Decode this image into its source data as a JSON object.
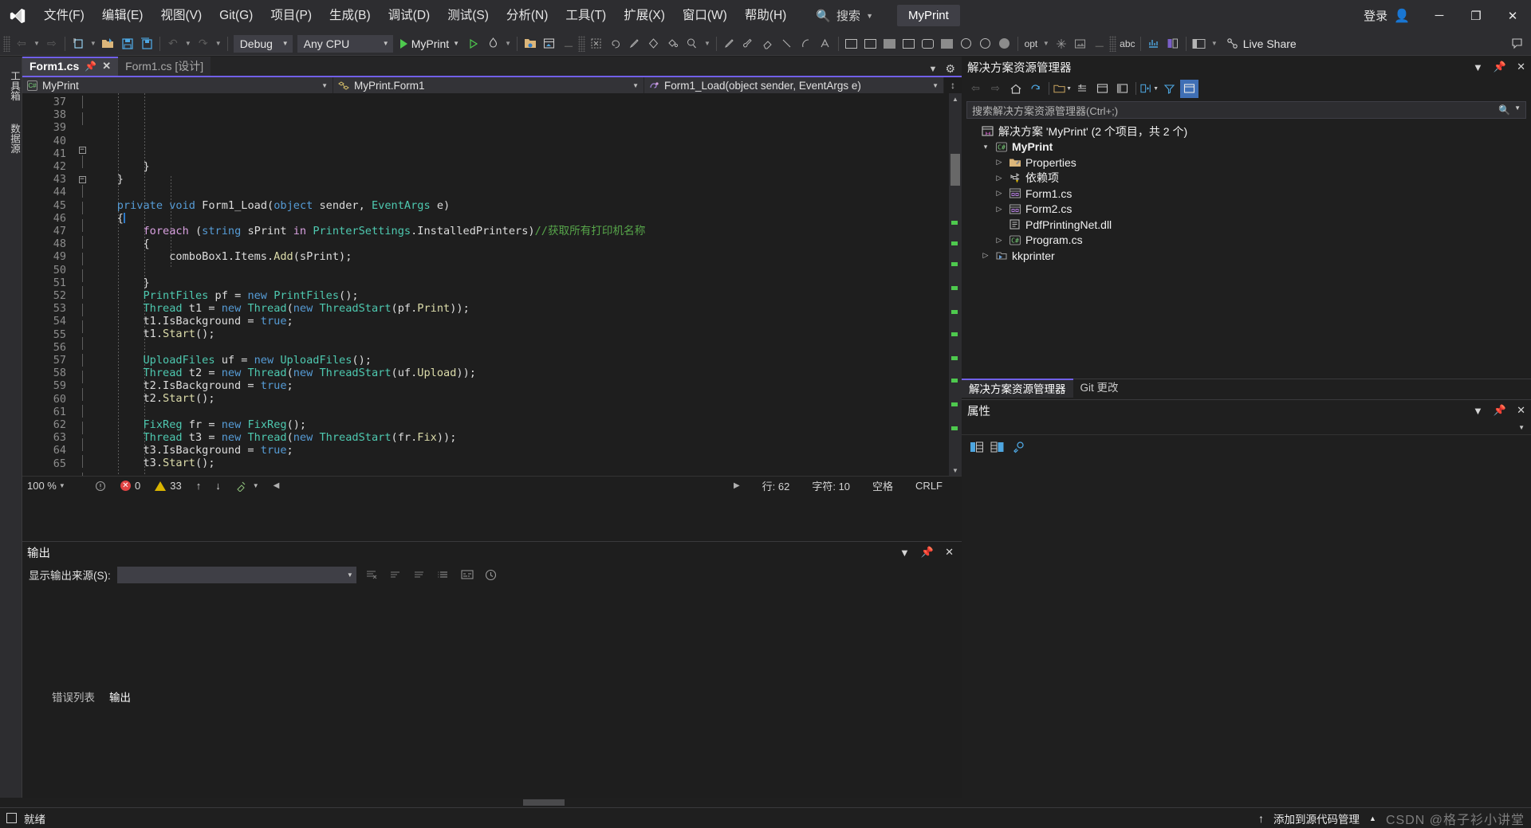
{
  "titlebar": {
    "logo_icon": "visual-studio-logo",
    "menus": [
      "文件(F)",
      "编辑(E)",
      "视图(V)",
      "Git(G)",
      "项目(P)",
      "生成(B)",
      "调试(D)",
      "测试(S)",
      "分析(N)",
      "工具(T)",
      "扩展(X)",
      "窗口(W)",
      "帮助(H)"
    ],
    "search_icon": "search-icon",
    "search_label": "搜索",
    "project_badge": "MyPrint",
    "signin_label": "登录",
    "signin_icon": "person-icon",
    "minimize": "─",
    "maximize": "❐",
    "close": "✕"
  },
  "toolbar": {
    "nav_back": "←",
    "nav_forward": "→",
    "new_item_icon": "new-item-icon",
    "open_file_icon": "open-folder-icon",
    "save_icon": "save-icon",
    "save_all_icon": "save-all-icon",
    "undo_icon": "undo-icon",
    "redo_icon": "redo-icon",
    "config_value": "Debug",
    "platform_value": "Any CPU",
    "start_label": "MyPrint",
    "start_icon": "play-icon",
    "hot_reload_icon": "hot-reload-icon",
    "live_share_label": "Live Share",
    "live_share_icon": "live-share-icon",
    "opt_label": "opt",
    "abc_label": "abc",
    "feedback_icon": "feedback-icon"
  },
  "left_rail": {
    "toolbox": "工具箱",
    "data_sources": "数据源"
  },
  "editor": {
    "tabs": [
      {
        "label": "Form1.cs",
        "active": true,
        "pin_icon": "pin-icon",
        "close_icon": "close-icon"
      },
      {
        "label": "Form1.cs [设计]",
        "active": false
      }
    ],
    "nav": {
      "project": "MyPrint",
      "project_icon": "csharp-project-icon",
      "class": "MyPrint.Form1",
      "class_icon": "class-icon",
      "member": "Form1_Load(object sender, EventArgs e)",
      "member_icon": "method-icon"
    },
    "first_line": 37,
    "lines": [
      {
        "n": 37,
        "fold": "line",
        "tokens": [
          {
            "t": "        }",
            "c": "pl"
          }
        ]
      },
      {
        "n": 38,
        "fold": "line",
        "tokens": [
          {
            "t": "    }",
            "c": "pl"
          }
        ]
      },
      {
        "n": 39,
        "fold": "",
        "tokens": [
          {
            "t": "",
            "c": "pl"
          }
        ]
      },
      {
        "n": 40,
        "fold": "minus",
        "tokens": [
          {
            "t": "    ",
            "c": "pl"
          },
          {
            "t": "private",
            "c": "k"
          },
          {
            "t": " ",
            "c": "pl"
          },
          {
            "t": "void",
            "c": "k"
          },
          {
            "t": " Form1_Load(",
            "c": "pl"
          },
          {
            "t": "object",
            "c": "k"
          },
          {
            "t": " sender, ",
            "c": "pl"
          },
          {
            "t": "EventArgs",
            "c": "t"
          },
          {
            "t": " e)",
            "c": "pl"
          }
        ]
      },
      {
        "n": 41,
        "fold": "line",
        "tokens": [
          {
            "t": "    {",
            "c": "pl"
          }
        ]
      },
      {
        "n": 42,
        "fold": "minus",
        "tokens": [
          {
            "t": "        ",
            "c": "pl"
          },
          {
            "t": "foreach",
            "c": "ctrl"
          },
          {
            "t": " (",
            "c": "pl"
          },
          {
            "t": "string",
            "c": "k"
          },
          {
            "t": " sPrint ",
            "c": "pl"
          },
          {
            "t": "in",
            "c": "ctrl"
          },
          {
            "t": " ",
            "c": "pl"
          },
          {
            "t": "PrinterSettings",
            "c": "t"
          },
          {
            "t": ".InstalledPrinters)",
            "c": "pl"
          },
          {
            "t": "//获取所有打印机名称",
            "c": "cm"
          }
        ]
      },
      {
        "n": 43,
        "fold": "line",
        "tokens": [
          {
            "t": "        {",
            "c": "pl"
          }
        ]
      },
      {
        "n": 44,
        "fold": "line",
        "tokens": [
          {
            "t": "            comboBox1.Items.",
            "c": "pl"
          },
          {
            "t": "Add",
            "c": "m"
          },
          {
            "t": "(sPrint);",
            "c": "pl"
          }
        ]
      },
      {
        "n": 45,
        "fold": "line",
        "tokens": [
          {
            "t": "",
            "c": "pl"
          }
        ]
      },
      {
        "n": 46,
        "fold": "line",
        "tokens": [
          {
            "t": "        }",
            "c": "pl"
          }
        ]
      },
      {
        "n": 47,
        "fold": "line",
        "tokens": [
          {
            "t": "        ",
            "c": "pl"
          },
          {
            "t": "PrintFiles",
            "c": "t"
          },
          {
            "t": " pf = ",
            "c": "pl"
          },
          {
            "t": "new",
            "c": "k"
          },
          {
            "t": " ",
            "c": "pl"
          },
          {
            "t": "PrintFiles",
            "c": "t"
          },
          {
            "t": "();",
            "c": "pl"
          }
        ]
      },
      {
        "n": 48,
        "fold": "line",
        "tokens": [
          {
            "t": "        ",
            "c": "pl"
          },
          {
            "t": "Thread",
            "c": "t"
          },
          {
            "t": " t1 = ",
            "c": "pl"
          },
          {
            "t": "new",
            "c": "k"
          },
          {
            "t": " ",
            "c": "pl"
          },
          {
            "t": "Thread",
            "c": "t"
          },
          {
            "t": "(",
            "c": "pl"
          },
          {
            "t": "new",
            "c": "k"
          },
          {
            "t": " ",
            "c": "pl"
          },
          {
            "t": "ThreadStart",
            "c": "t"
          },
          {
            "t": "(pf.",
            "c": "pl"
          },
          {
            "t": "Print",
            "c": "m"
          },
          {
            "t": "));",
            "c": "pl"
          }
        ]
      },
      {
        "n": 49,
        "fold": "line",
        "tokens": [
          {
            "t": "        t1.IsBackground = ",
            "c": "pl"
          },
          {
            "t": "true",
            "c": "k"
          },
          {
            "t": ";",
            "c": "pl"
          }
        ]
      },
      {
        "n": 50,
        "fold": "line",
        "tokens": [
          {
            "t": "        t1.",
            "c": "pl"
          },
          {
            "t": "Start",
            "c": "m"
          },
          {
            "t": "();",
            "c": "pl"
          }
        ]
      },
      {
        "n": 51,
        "fold": "line",
        "tokens": [
          {
            "t": "",
            "c": "pl"
          }
        ]
      },
      {
        "n": 52,
        "fold": "line",
        "tokens": [
          {
            "t": "        ",
            "c": "pl"
          },
          {
            "t": "UploadFiles",
            "c": "t"
          },
          {
            "t": " uf = ",
            "c": "pl"
          },
          {
            "t": "new",
            "c": "k"
          },
          {
            "t": " ",
            "c": "pl"
          },
          {
            "t": "UploadFiles",
            "c": "t"
          },
          {
            "t": "();",
            "c": "pl"
          }
        ]
      },
      {
        "n": 53,
        "fold": "line",
        "tokens": [
          {
            "t": "        ",
            "c": "pl"
          },
          {
            "t": "Thread",
            "c": "t"
          },
          {
            "t": " t2 = ",
            "c": "pl"
          },
          {
            "t": "new",
            "c": "k"
          },
          {
            "t": " ",
            "c": "pl"
          },
          {
            "t": "Thread",
            "c": "t"
          },
          {
            "t": "(",
            "c": "pl"
          },
          {
            "t": "new",
            "c": "k"
          },
          {
            "t": " ",
            "c": "pl"
          },
          {
            "t": "ThreadStart",
            "c": "t"
          },
          {
            "t": "(uf.",
            "c": "pl"
          },
          {
            "t": "Upload",
            "c": "m"
          },
          {
            "t": "));",
            "c": "pl"
          }
        ]
      },
      {
        "n": 54,
        "fold": "line",
        "tokens": [
          {
            "t": "        t2.IsBackground = ",
            "c": "pl"
          },
          {
            "t": "true",
            "c": "k"
          },
          {
            "t": ";",
            "c": "pl"
          }
        ]
      },
      {
        "n": 55,
        "fold": "line",
        "tokens": [
          {
            "t": "        t2.",
            "c": "pl"
          },
          {
            "t": "Start",
            "c": "m"
          },
          {
            "t": "();",
            "c": "pl"
          }
        ]
      },
      {
        "n": 56,
        "fold": "line",
        "tokens": [
          {
            "t": "",
            "c": "pl"
          }
        ]
      },
      {
        "n": 57,
        "fold": "line",
        "tokens": [
          {
            "t": "        ",
            "c": "pl"
          },
          {
            "t": "FixReg",
            "c": "t"
          },
          {
            "t": " fr = ",
            "c": "pl"
          },
          {
            "t": "new",
            "c": "k"
          },
          {
            "t": " ",
            "c": "pl"
          },
          {
            "t": "FixReg",
            "c": "t"
          },
          {
            "t": "();",
            "c": "pl"
          }
        ]
      },
      {
        "n": 58,
        "fold": "line",
        "tokens": [
          {
            "t": "        ",
            "c": "pl"
          },
          {
            "t": "Thread",
            "c": "t"
          },
          {
            "t": " t3 = ",
            "c": "pl"
          },
          {
            "t": "new",
            "c": "k"
          },
          {
            "t": " ",
            "c": "pl"
          },
          {
            "t": "Thread",
            "c": "t"
          },
          {
            "t": "(",
            "c": "pl"
          },
          {
            "t": "new",
            "c": "k"
          },
          {
            "t": " ",
            "c": "pl"
          },
          {
            "t": "ThreadStart",
            "c": "t"
          },
          {
            "t": "(fr.",
            "c": "pl"
          },
          {
            "t": "Fix",
            "c": "m"
          },
          {
            "t": "));",
            "c": "pl"
          }
        ]
      },
      {
        "n": 59,
        "fold": "line",
        "tokens": [
          {
            "t": "        t3.IsBackground = ",
            "c": "pl"
          },
          {
            "t": "true",
            "c": "k"
          },
          {
            "t": ";",
            "c": "pl"
          }
        ]
      },
      {
        "n": 60,
        "fold": "line",
        "tokens": [
          {
            "t": "        t3.",
            "c": "pl"
          },
          {
            "t": "Start",
            "c": "m"
          },
          {
            "t": "();",
            "c": "pl"
          }
        ]
      },
      {
        "n": 61,
        "fold": "line",
        "tokens": [
          {
            "t": "",
            "c": "pl"
          }
        ]
      },
      {
        "n": 62,
        "fold": "line",
        "current": true,
        "tokens": [
          {
            "t": "    }",
            "c": "pl"
          }
        ]
      },
      {
        "n": 63,
        "fold": "",
        "tokens": [
          {
            "t": "",
            "c": "pl"
          }
        ]
      },
      {
        "n": 64,
        "fold": "",
        "tokens": [
          {
            "t": "",
            "c": "pl"
          }
        ]
      },
      {
        "n": 65,
        "fold": "",
        "tokens": [
          {
            "t": "",
            "c": "pl"
          }
        ]
      }
    ],
    "status": {
      "zoom": "100 %",
      "errors": "0",
      "warnings": "33",
      "up_arrow": "↑",
      "down_arrow": "↓",
      "line_label": "行: 62",
      "col_label": "字符: 10",
      "spaces_label": "空格",
      "eol_label": "CRLF"
    }
  },
  "output": {
    "title": "输出",
    "source_label": "显示输出来源(S):",
    "source_value": "",
    "tabs": [
      {
        "label": "错误列表",
        "active": false
      },
      {
        "label": "输出",
        "active": true
      }
    ],
    "content": "",
    "dropdown_icon": "chevron-down-icon",
    "pin_icon": "pin-icon",
    "close_icon": "close-icon"
  },
  "solution_explorer": {
    "title": "解决方案资源管理器",
    "dropdown_icon": "chevron-down-icon",
    "pin_icon": "pin-icon",
    "close_icon": "close-icon",
    "search_placeholder": "搜索解决方案资源管理器(Ctrl+;)",
    "search_icon": "search-icon",
    "toolbar_icons": [
      "back-icon",
      "forward-icon",
      "home-icon",
      "refresh-icon",
      "show-all-files-icon",
      "collapse-all-icon",
      "view-code-icon",
      "properties-icon",
      "sync-icon",
      "filter-icon",
      "preview-icon"
    ],
    "tree": [
      {
        "indent": 0,
        "twisty": "",
        "icon": "solution-icon",
        "label": "解决方案 'MyPrint' (2 个项目，共 2 个)",
        "bold": false
      },
      {
        "indent": 1,
        "twisty": "down",
        "icon": "csharp-project-icon",
        "label": "MyPrint",
        "bold": true,
        "selected": false
      },
      {
        "indent": 2,
        "twisty": "right",
        "icon": "properties-folder-icon",
        "label": "Properties",
        "bold": false
      },
      {
        "indent": 2,
        "twisty": "right",
        "icon": "dependencies-warning-icon",
        "label": "依赖项",
        "bold": false
      },
      {
        "indent": 2,
        "twisty": "right",
        "icon": "form-icon",
        "label": "Form1.cs",
        "bold": false
      },
      {
        "indent": 2,
        "twisty": "right",
        "icon": "form-icon",
        "label": "Form2.cs",
        "bold": false
      },
      {
        "indent": 2,
        "twisty": "",
        "icon": "dll-icon",
        "label": "PdfPrintingNet.dll",
        "bold": false
      },
      {
        "indent": 2,
        "twisty": "right",
        "icon": "csharp-file-icon",
        "label": "Program.cs",
        "bold": false
      },
      {
        "indent": 1,
        "twisty": "right",
        "icon": "project-icon",
        "label": "kkprinter",
        "bold": false
      }
    ],
    "bottom_tabs": [
      {
        "label": "解决方案资源管理器",
        "active": true
      },
      {
        "label": "Git 更改",
        "active": false
      }
    ]
  },
  "properties": {
    "title": "属性",
    "dropdown_icon": "chevron-down-icon",
    "pin_icon": "pin-icon",
    "close_icon": "close-icon",
    "toolbar_icons": [
      "categorized-icon",
      "alphabetical-icon",
      "properties-page-icon"
    ]
  },
  "statusbar": {
    "ready_label": "就绪",
    "ready_icon": "status-icon",
    "source_control_label": "添加到源代码管理",
    "source_control_icon": "upload-icon",
    "caret_icon": "chevron-up-icon",
    "watermark": "CSDN @格子衫小讲堂"
  },
  "colors": {
    "accent_purple": "#7160e8",
    "keyword_blue": "#569cd6",
    "type_teal": "#4ec9b0",
    "comment_green": "#57a64a",
    "method_yellow": "#dcdcaa",
    "control_purple": "#d8a0df",
    "titlebar_bg": "#2d2d30",
    "editor_bg": "#1e1e1e",
    "panel_bg": "#1f1f1f",
    "error_red": "#e04343",
    "warning_yellow": "#d9b400"
  }
}
